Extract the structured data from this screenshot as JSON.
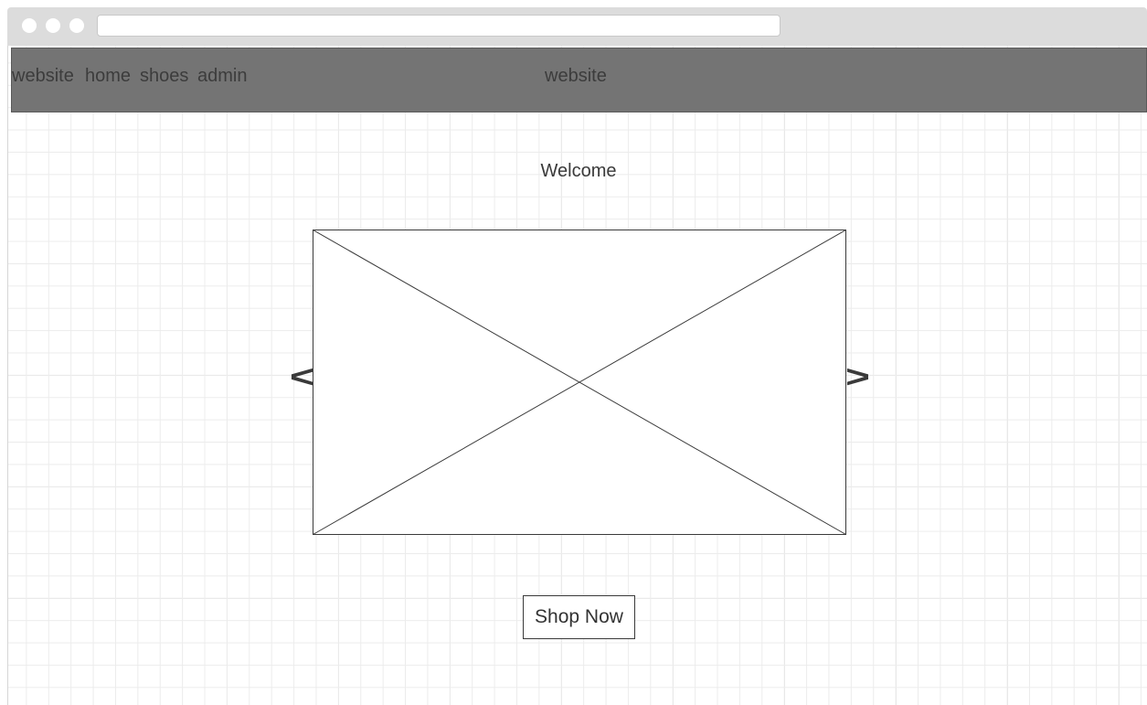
{
  "nav": {
    "items": [
      "website",
      "home",
      "shoes",
      "admin"
    ],
    "center_title": "website"
  },
  "main": {
    "heading": "Welcome",
    "prev_arrow": "<",
    "next_arrow": ">",
    "cta_label": "Shop Now"
  },
  "colors": {
    "navbar_bg": "#747474",
    "chrome_bg": "#dcdcdc",
    "text": "#3a3a3a"
  }
}
